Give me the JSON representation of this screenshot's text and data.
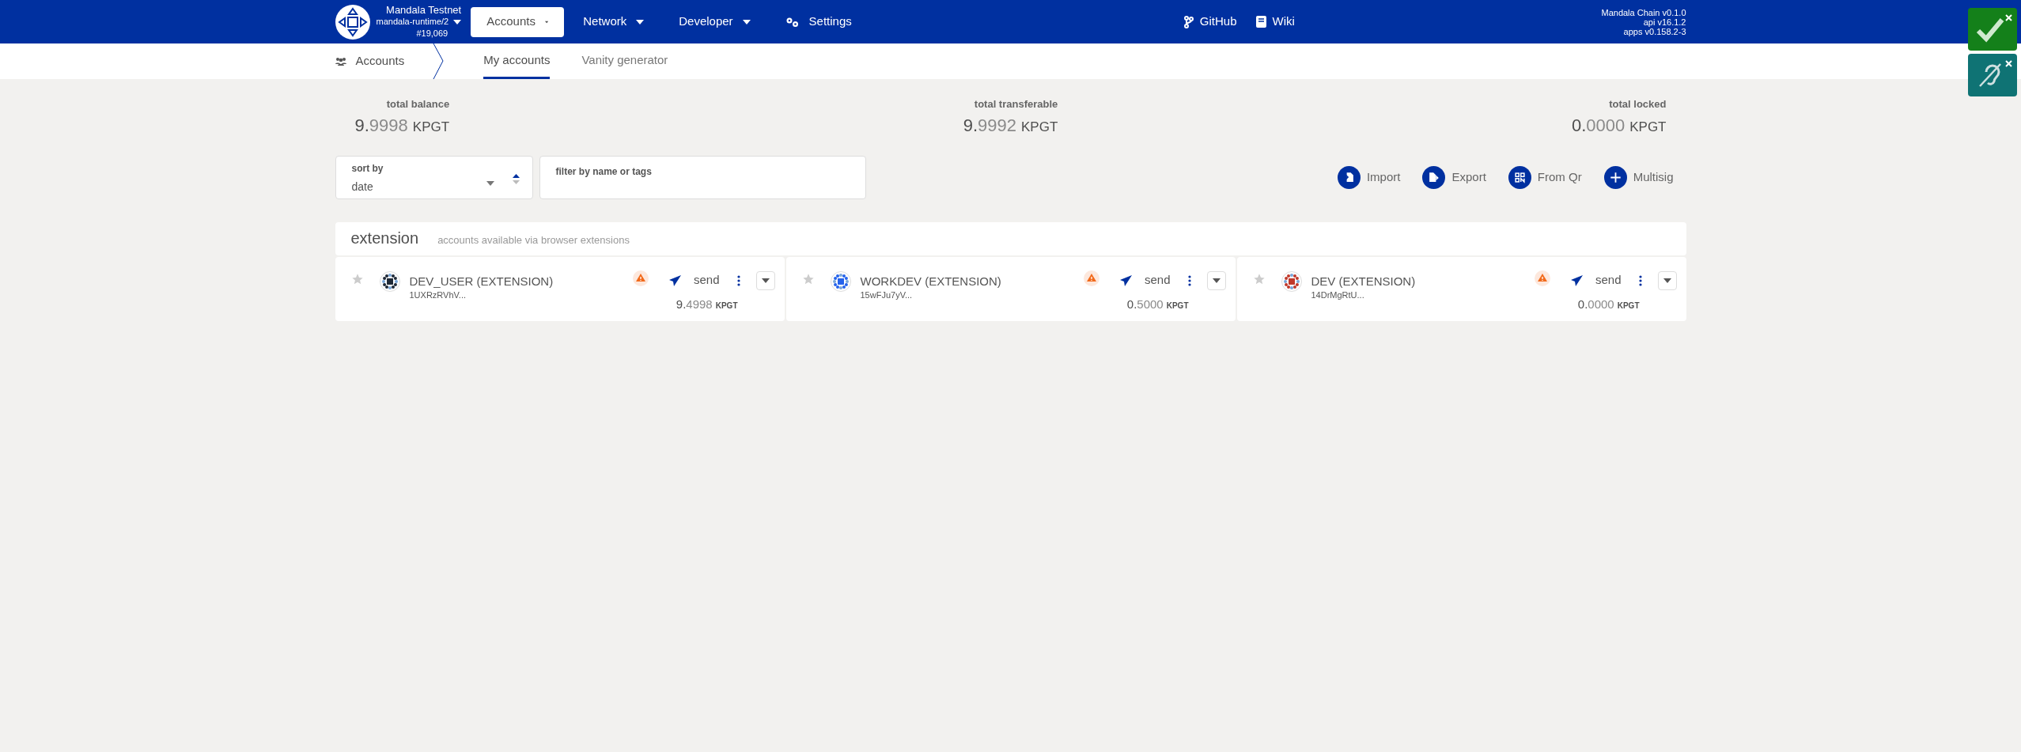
{
  "header": {
    "chain": {
      "name": "Mandala Testnet",
      "runtime": "mandala-runtime/2",
      "block": "#19,069"
    },
    "nav": [
      {
        "label": "Accounts",
        "kind": "dropdown",
        "selected": true
      },
      {
        "label": "Network",
        "kind": "dropdown",
        "selected": false
      },
      {
        "label": "Developer",
        "kind": "dropdown",
        "selected": false
      },
      {
        "label": "Settings",
        "kind": "settings",
        "selected": false
      }
    ],
    "links": [
      {
        "label": "GitHub",
        "kind": "github"
      },
      {
        "label": "Wiki",
        "kind": "wiki"
      }
    ],
    "versions": [
      "Mandala Chain v0.1.0",
      "api v16.1.2",
      "apps v0.158.2-3"
    ]
  },
  "subnav": {
    "section": "Accounts",
    "tabs": [
      {
        "label": "My accounts",
        "selected": true
      },
      {
        "label": "Vanity generator",
        "selected": false
      }
    ]
  },
  "summary": [
    {
      "label": "total balance",
      "value": "9.9998",
      "unit": "KPGT"
    },
    {
      "label": "total transferable",
      "value": "9.9992",
      "unit": "KPGT"
    },
    {
      "label": "total locked",
      "value": "0.0000",
      "unit": "KPGT"
    }
  ],
  "sort": {
    "label": "sort by",
    "value": "date"
  },
  "filter": {
    "label": "filter by name or tags"
  },
  "actions": [
    {
      "label": "Import",
      "kind": "import"
    },
    {
      "label": "Export",
      "kind": "export"
    },
    {
      "label": "From Qr",
      "kind": "qr"
    },
    {
      "label": "Multisig",
      "kind": "add"
    }
  ],
  "group": {
    "title": "extension",
    "subtitle": "accounts available via browser extensions",
    "accounts": [
      {
        "name": "DEV_USER (EXTENSION)",
        "address": "1UXRzRVhV...",
        "send": "send",
        "balance": "9.4998",
        "unit": "KPGT",
        "favorite": false,
        "color": "#1f2937"
      },
      {
        "name": "WORKDEV (EXTENSION)",
        "address": "15wFJu7yV...",
        "send": "send",
        "balance": "0.5000",
        "unit": "KPGT",
        "favorite": false,
        "color": "#2563eb"
      },
      {
        "name": "DEV (EXTENSION)",
        "address": "14DrMgRtU...",
        "send": "send",
        "balance": "0.0000",
        "unit": "KPGT",
        "favorite": false,
        "color": "#c0392b"
      }
    ]
  }
}
